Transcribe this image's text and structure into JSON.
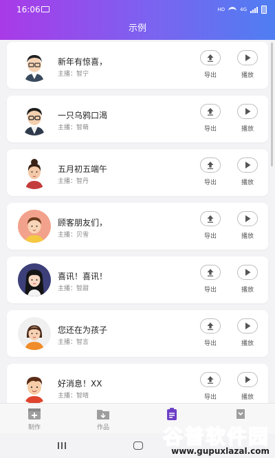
{
  "status": {
    "time": "16:06",
    "network": "HD",
    "signal_gen": "4G"
  },
  "header": {
    "title": "示例"
  },
  "actions": {
    "export": "导出",
    "play": "播放"
  },
  "items": [
    {
      "title": "新年有惊喜，",
      "anchor": "主播：智宁",
      "avatar": "avatar-man-glasses"
    },
    {
      "title": "一只乌鸦口渴",
      "anchor": "主播：智萌",
      "avatar": "avatar-man-glasses-vest"
    },
    {
      "title": "五月初五端午",
      "anchor": "主播：智丹",
      "avatar": "avatar-woman-bun"
    },
    {
      "title": "顾客朋友们，",
      "anchor": "主播：贝雪",
      "avatar": "avatar-boy-yellow"
    },
    {
      "title": "喜讯！喜讯！",
      "anchor": "主播：智甜",
      "avatar": "avatar-woman-long-hair"
    },
    {
      "title": "您还在为孩子",
      "anchor": "主播：智言",
      "avatar": "avatar-woman-orange"
    },
    {
      "title": "好消息！XX",
      "anchor": "主播：智晴",
      "avatar": "avatar-boy-red"
    }
  ],
  "tabs": [
    {
      "label": "制作",
      "icon": "add-box-icon",
      "active": false
    },
    {
      "label": "作品",
      "icon": "folder-icon",
      "active": false
    },
    {
      "label": "",
      "icon": "clipboard-icon",
      "active": true
    },
    {
      "label": "",
      "icon": "profile-icon",
      "active": false
    }
  ],
  "watermark": {
    "text": "谷普软件园",
    "url": "www.gupuxlazal.com"
  },
  "colors": {
    "header_start": "#a93ae8",
    "header_end": "#4f7ef2",
    "active_tab": "#6c3fc6"
  }
}
